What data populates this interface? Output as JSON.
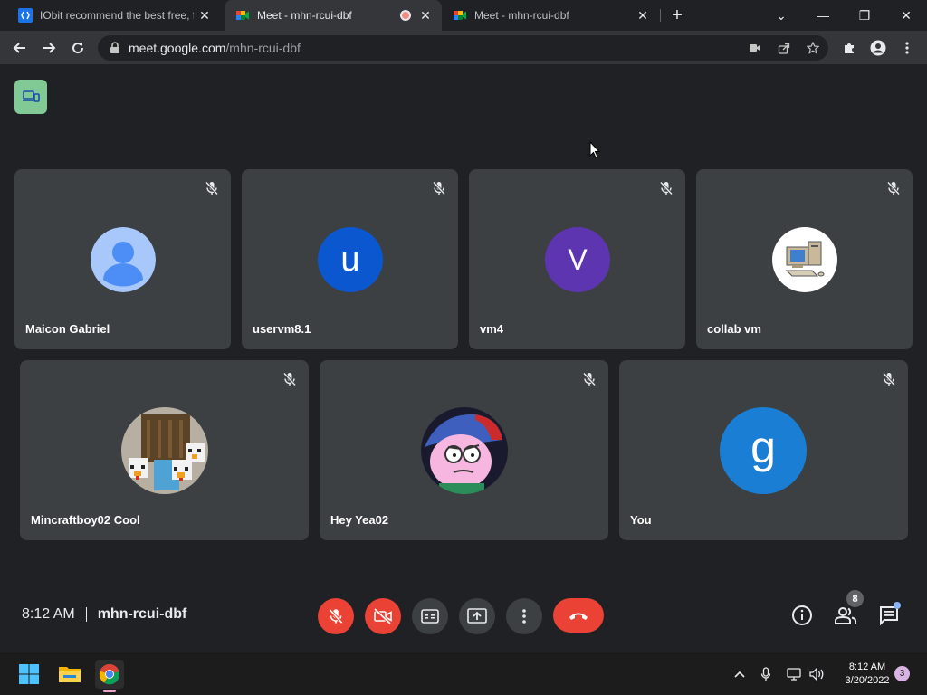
{
  "browser": {
    "tabs": [
      {
        "title": "IObit recommend the best free, f",
        "close": "✕"
      },
      {
        "title": "Meet - mhn-rcui-dbf",
        "close": "✕"
      },
      {
        "title": "Meet - mhn-rcui-dbf",
        "close": "✕"
      }
    ],
    "new_tab": "+",
    "window_controls": {
      "list": "⌄",
      "minimize": "—",
      "restore": "❐",
      "close": "✕"
    },
    "url": {
      "domain": "meet.google.com",
      "path": "/mhn-rcui-dbf"
    }
  },
  "meet": {
    "participants_row1": [
      {
        "name": "Maicon Gabriel",
        "initial": "",
        "avatar_color": "#a8c7fa",
        "avatar_type": "default-person"
      },
      {
        "name": "uservm8.1",
        "initial": "u",
        "avatar_color": "#0b57d0",
        "avatar_type": "letter"
      },
      {
        "name": "vm4",
        "initial": "V",
        "avatar_color": "#5e35b1",
        "avatar_type": "letter"
      },
      {
        "name": "collab vm",
        "initial": "",
        "avatar_color": "#ffffff",
        "avatar_type": "computer-picture"
      }
    ],
    "participants_row2": [
      {
        "name": "Mincraftboy02 Cool",
        "initial": "",
        "avatar_color": "#8a7a5a",
        "avatar_type": "minecraft-picture"
      },
      {
        "name": "Hey Yea02",
        "initial": "",
        "avatar_color": "#1a237e",
        "avatar_type": "cartoon-picture"
      },
      {
        "name": "You",
        "initial": "g",
        "avatar_color": "#1a7fd4",
        "avatar_type": "letter"
      }
    ],
    "time": "8:12 AM",
    "meeting_code": "mhn-rcui-dbf",
    "people_count": "8",
    "colors": {
      "danger": "#ea4335",
      "tile": "#3c4043",
      "background": "#202124"
    }
  },
  "taskbar": {
    "time": "8:12 AM",
    "date": "3/20/2022",
    "notification_count": "3",
    "tray_chevron": "^"
  }
}
